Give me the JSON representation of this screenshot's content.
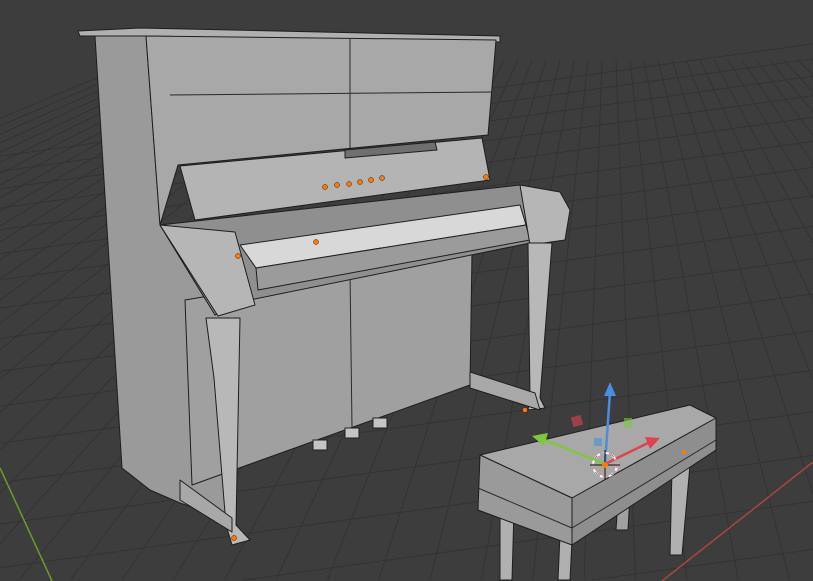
{
  "viewport": {
    "background": "#3d3d3d",
    "grid_color": "#333333",
    "x_axis_color": "#a8463f",
    "y_axis_color": "#6b9a2c"
  },
  "model": {
    "surface_color": "#a5a5a5",
    "shade_color": "#8c8c8c",
    "dark_color": "#6a6a6a",
    "key_color": "#d8d8d8",
    "vertex_color": "#ff7b00"
  },
  "gizmo": {
    "x_color": "#e0434e",
    "y_color": "#7ec83e",
    "z_color": "#4a8ee0"
  }
}
